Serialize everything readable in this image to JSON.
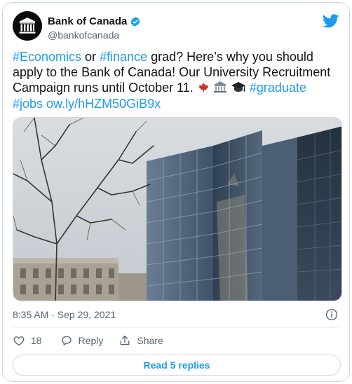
{
  "account": {
    "name": "Bank of Canada",
    "handle": "@bankofcanada",
    "verified": true
  },
  "tweet": {
    "parts": {
      "hashtag_economics": "#Economics",
      "or": " or ",
      "hashtag_finance": "#finance",
      "body": " grad? Here’s why you should apply to the Bank of Canada! Our University Recruitment Campaign runs until October 11. ",
      "hashtag_graduate": "#graduate",
      "hashtag_jobs": "#jobs",
      "link": "ow.ly/hHZM50GiB9x"
    },
    "emojis": [
      "maple-leaf",
      "bank-building",
      "graduation-cap"
    ]
  },
  "timestamp": "8:35 AM · Sep 29, 2021",
  "actions": {
    "like_count": "18",
    "reply_label": "Reply",
    "share_label": "Share"
  },
  "read_replies_label": "Read 5 replies",
  "colors": {
    "accent": "#1d9bf0",
    "text": "#0f1419",
    "muted": "#536471",
    "border": "#cfd9de"
  }
}
